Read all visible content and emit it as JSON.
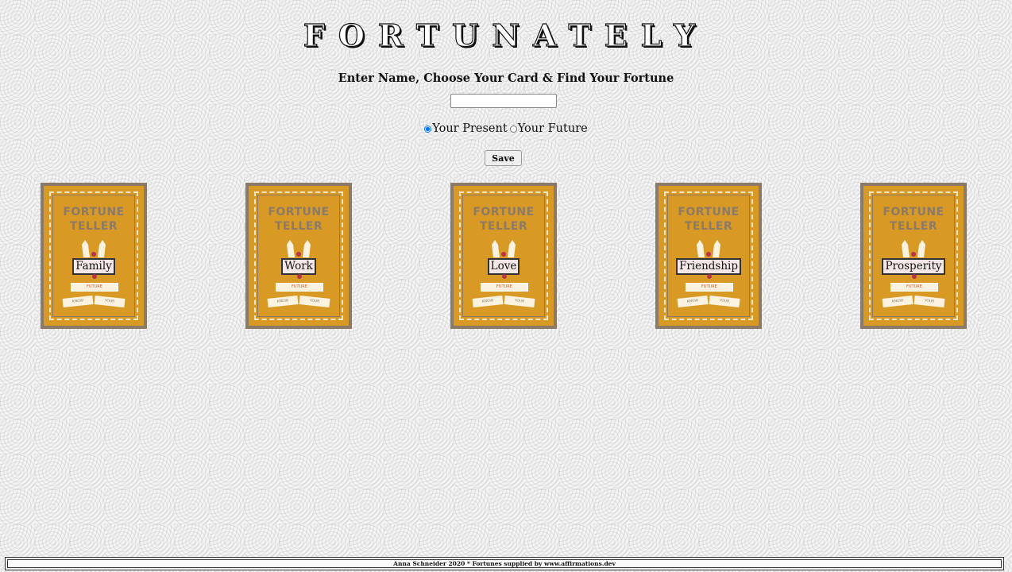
{
  "header": {
    "title": "FORTUNATELY",
    "subtitle": "Enter Name, Choose Your Card & Find Your Fortune"
  },
  "form": {
    "name_value": "",
    "name_placeholder": "",
    "radio_options": [
      {
        "label": "Your Present",
        "checked": true
      },
      {
        "label": "Your Future",
        "checked": false
      }
    ],
    "save_label": "Save"
  },
  "cards": [
    {
      "label": "Family"
    },
    {
      "label": "Work"
    },
    {
      "label": "Love"
    },
    {
      "label": "Friendship"
    },
    {
      "label": "Prosperity"
    }
  ],
  "card_art": {
    "heading_line1": "FORTUNE",
    "heading_line2": "TELLER",
    "banner": "FUTURE",
    "ribbon_left": "KNOW",
    "ribbon_right": "YOUR"
  },
  "footer": {
    "text": "Anna Schneider 2020 * Fortunes supplied by www.affirmations.dev"
  },
  "colors": {
    "card_background": "#d89a25",
    "card_border": "#8b7a68",
    "label_background": "#f6e7e7"
  }
}
